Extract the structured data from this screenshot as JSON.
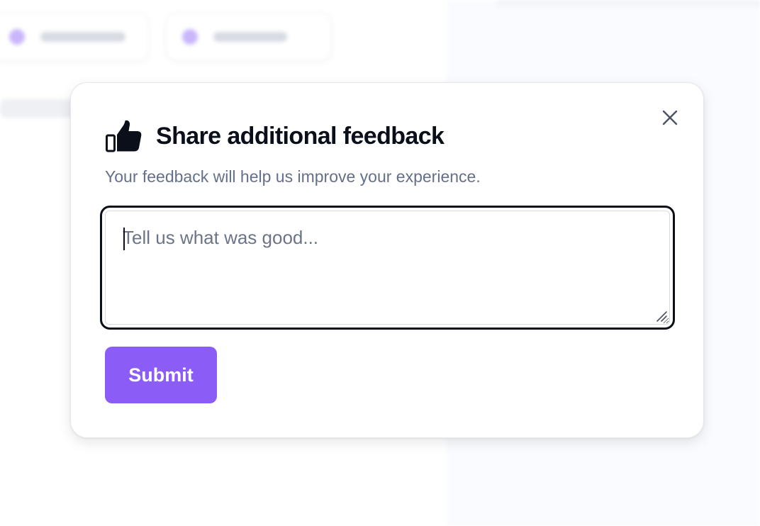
{
  "modal": {
    "title": "Share additional feedback",
    "subtitle": "Your feedback will help us improve your experience.",
    "feedback": {
      "value": "",
      "placeholder": "Tell us what was good..."
    },
    "submit_label": "Submit",
    "icons": {
      "header": "thumbs-up-icon",
      "close": "close-icon",
      "resize": "resize-grip-icon"
    }
  },
  "colors": {
    "accent": "#8b5cf6",
    "title": "#0b0f1a",
    "subtitle": "#64708a",
    "focus_ring": "#0b0f1a"
  }
}
